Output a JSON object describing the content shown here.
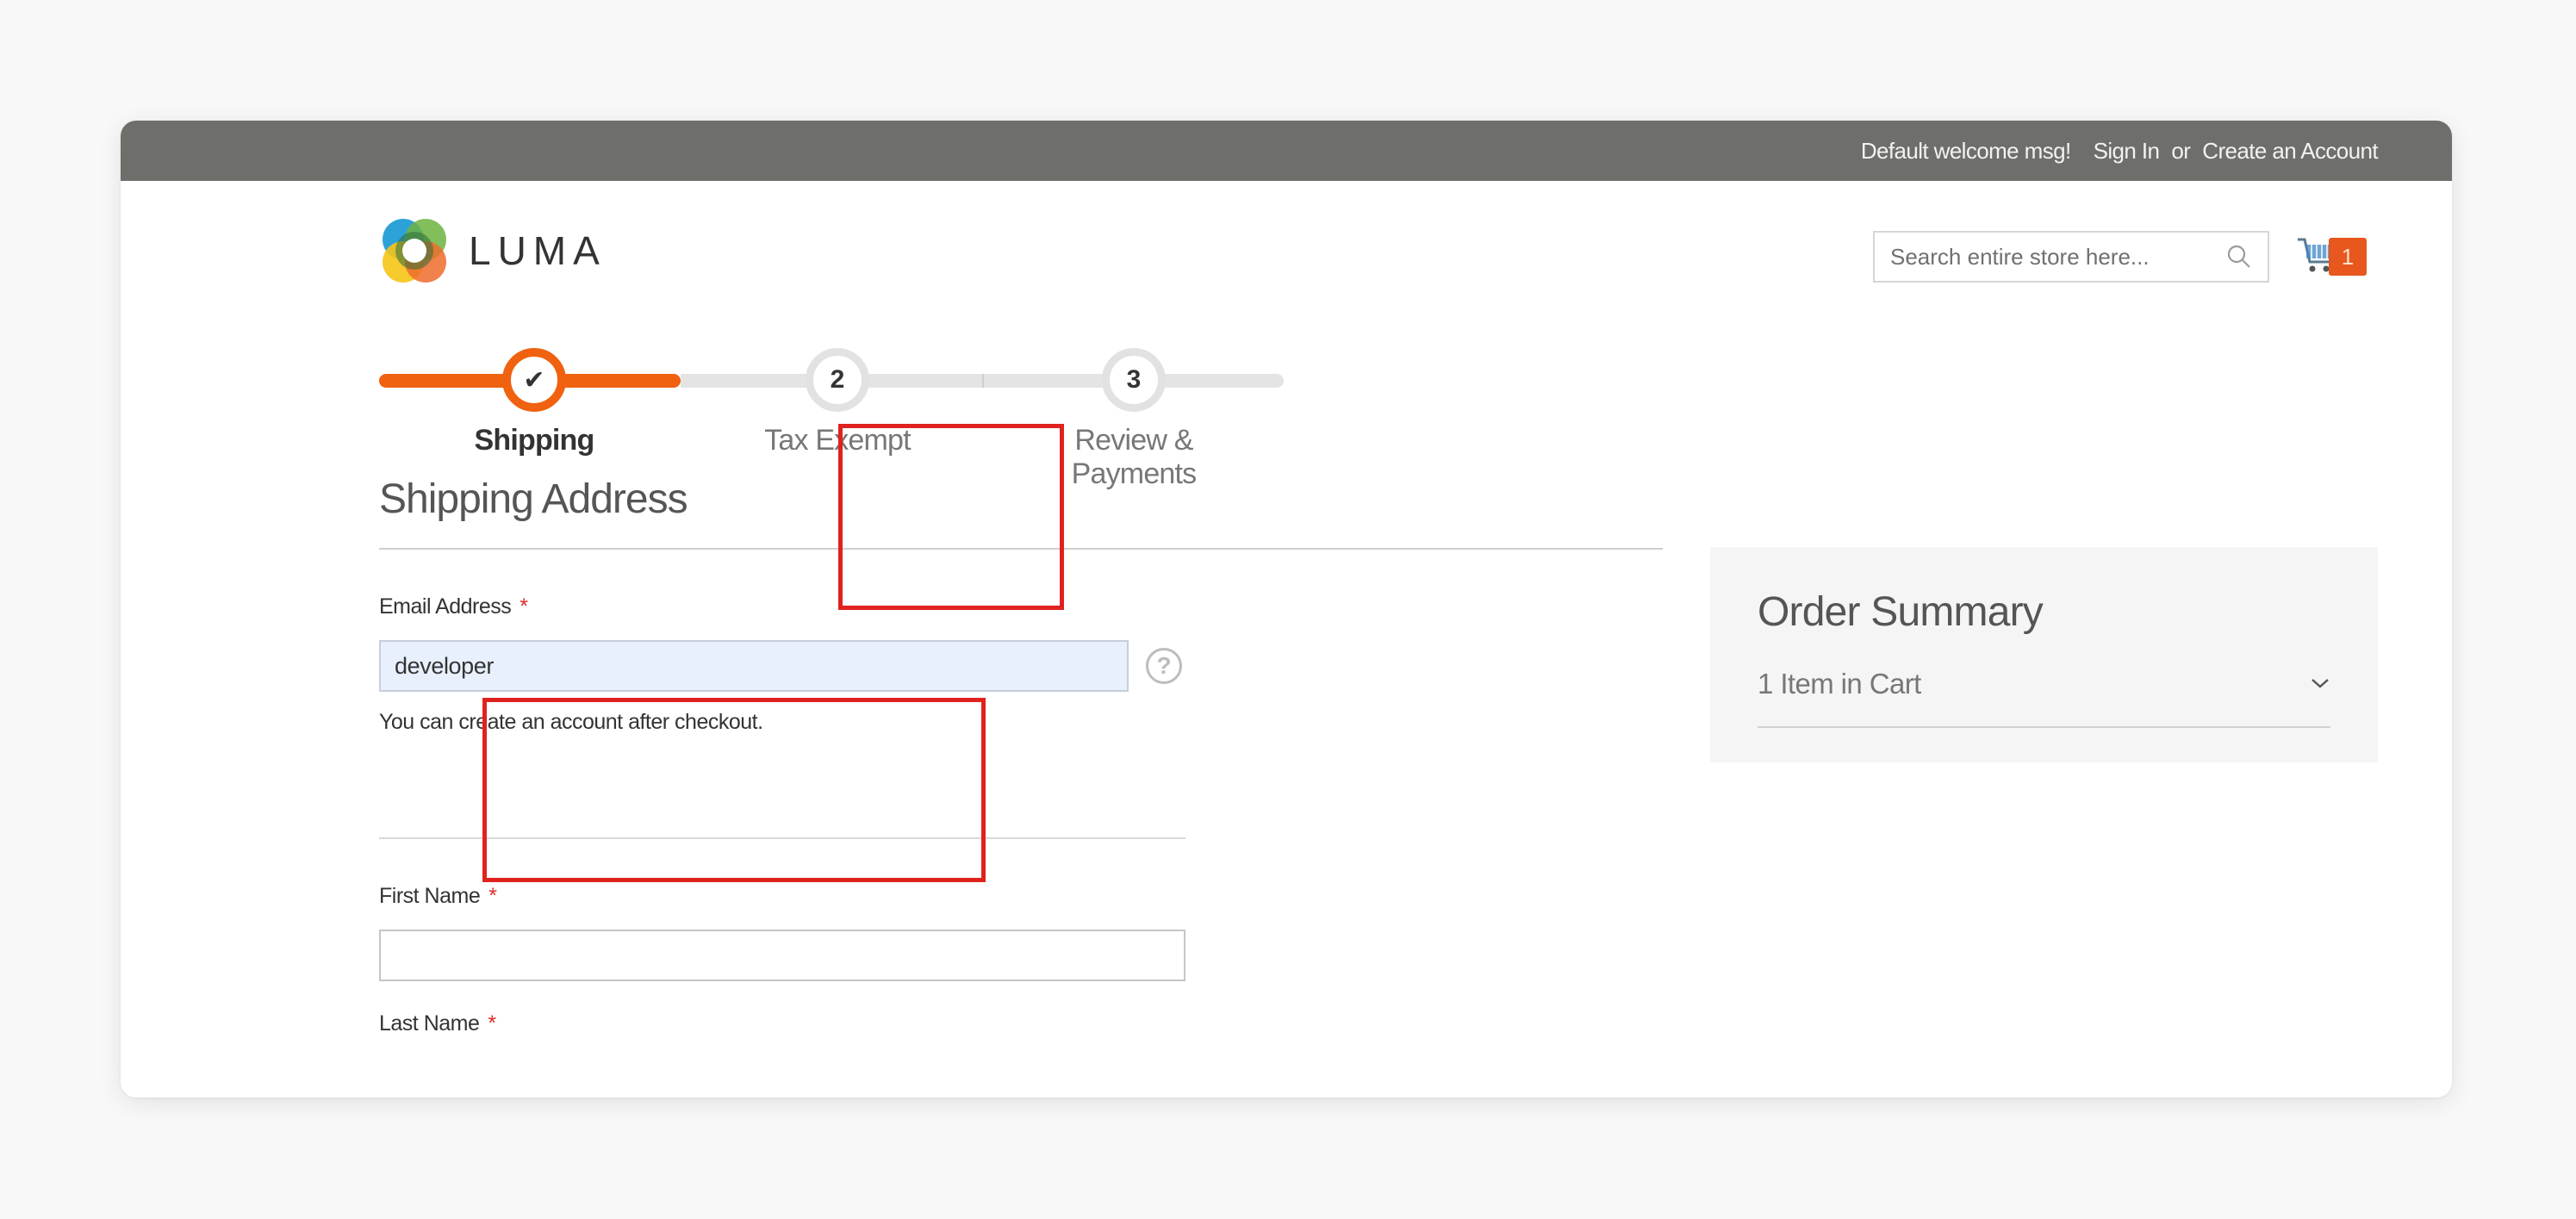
{
  "header": {
    "welcome": "Default welcome msg!",
    "sign_in": "Sign In",
    "or": "or",
    "create_account": "Create an Account"
  },
  "logo": {
    "text": "LUMA"
  },
  "search": {
    "placeholder": "Search entire store here...",
    "value": ""
  },
  "cart": {
    "count": "1"
  },
  "progress": {
    "steps": [
      {
        "number": "✔",
        "label": "Shipping",
        "state": "complete"
      },
      {
        "number": "2",
        "label": "Tax Exempt",
        "state": "pending"
      },
      {
        "number": "3",
        "label": "Review & Payments",
        "state": "pending"
      }
    ]
  },
  "shipping": {
    "title": "Shipping Address",
    "email": {
      "label": "Email Address",
      "required_mark": "*",
      "value": "developer",
      "note": "You can create an account after checkout.",
      "help": "?"
    },
    "first_name": {
      "label": "First Name",
      "required_mark": "*",
      "value": ""
    },
    "last_name": {
      "label": "Last Name",
      "required_mark": "*"
    }
  },
  "order_summary": {
    "title": "Order Summary",
    "items_label": "1 Item in Cart"
  },
  "colors": {
    "accent": "#f0620f",
    "topbar": "#6e6f6b",
    "annotation": "#e0221e",
    "cart_badge": "#e8571d"
  }
}
